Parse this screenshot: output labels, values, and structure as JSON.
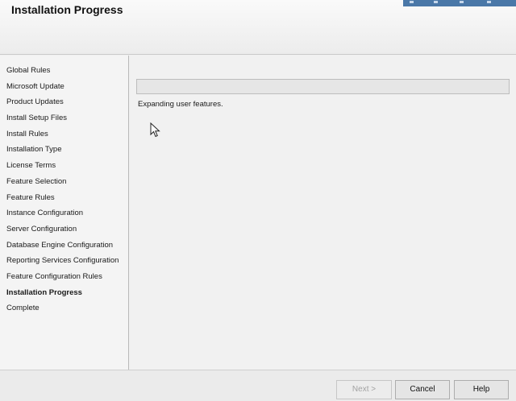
{
  "header": {
    "title": "Installation Progress"
  },
  "sidebar": {
    "steps": [
      {
        "label": "Global Rules"
      },
      {
        "label": "Microsoft Update"
      },
      {
        "label": "Product Updates"
      },
      {
        "label": "Install Setup Files"
      },
      {
        "label": "Install Rules"
      },
      {
        "label": "Installation Type"
      },
      {
        "label": "License Terms"
      },
      {
        "label": "Feature Selection"
      },
      {
        "label": "Feature Rules"
      },
      {
        "label": "Instance Configuration"
      },
      {
        "label": "Server Configuration"
      },
      {
        "label": "Database Engine Configuration"
      },
      {
        "label": "Reporting Services Configuration"
      },
      {
        "label": "Feature Configuration Rules"
      },
      {
        "label": "Installation Progress",
        "current": true
      },
      {
        "label": "Complete"
      }
    ]
  },
  "main": {
    "progress": 0,
    "status_text": "Expanding user features."
  },
  "footer": {
    "next_label": "Next >",
    "cancel_label": "Cancel",
    "help_label": "Help"
  },
  "colors": {
    "title_strip": "#4a78a8",
    "progress_fill": "#06b025"
  }
}
